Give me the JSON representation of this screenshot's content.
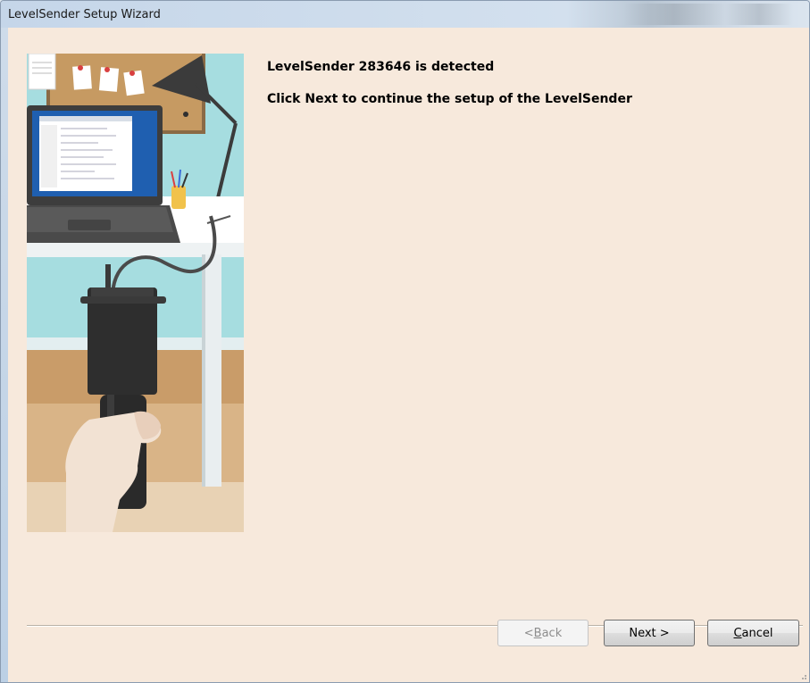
{
  "window": {
    "title": "LevelSender Setup Wizard"
  },
  "main": {
    "heading": "LevelSender 283646 is detected",
    "instruction": "Click Next to continue the setup of the LevelSender"
  },
  "illustration": {
    "icon": "levelsender-desk-illustration"
  },
  "buttons": {
    "back": {
      "prefix": "< ",
      "accel": "B",
      "rest": "ack",
      "enabled": false
    },
    "next": {
      "label": "Next >"
    },
    "cancel": {
      "accel": "C",
      "rest": "ancel"
    }
  },
  "colors": {
    "background": "#f7e9dc",
    "title_bar": "#c5d6e9"
  }
}
